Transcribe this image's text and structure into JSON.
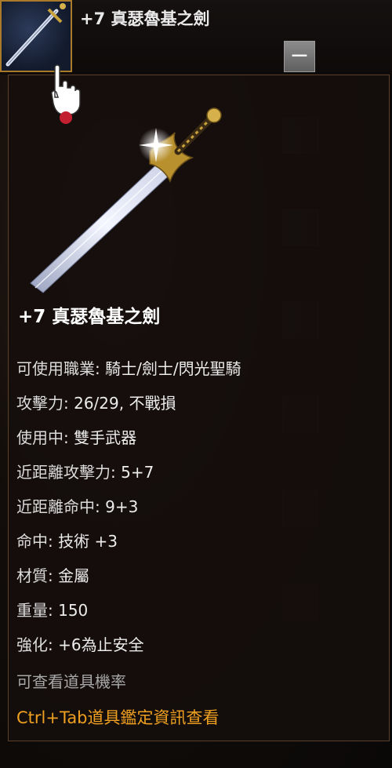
{
  "header": {
    "title": "+7 真瑟魯基之劍",
    "collapse_symbol": "−"
  },
  "tooltip": {
    "item_name": "+7 真瑟魯基之劍",
    "stats": [
      {
        "label": "可使用職業",
        "sep": ": ",
        "value": "騎士/劍士/閃光聖騎"
      },
      {
        "label": "攻擊力",
        "sep": ": ",
        "value": "26/29, 不戰損"
      },
      {
        "label": "使用中",
        "sep": ": ",
        "value": "雙手武器"
      },
      {
        "label": "近距離攻擊力",
        "sep": ": ",
        "value": "5+7"
      },
      {
        "label": "近距離命中",
        "sep": ": ",
        "value": "9+3"
      },
      {
        "label": "命中",
        "sep": ": ",
        "value": "技術 +3"
      },
      {
        "label": "材質",
        "sep": ": ",
        "value": "金屬"
      },
      {
        "label": "重量",
        "sep": ": ",
        "value": "150"
      },
      {
        "label": "強化",
        "sep": ": ",
        "value": "+6為止安全"
      }
    ],
    "hint_gray": "可查看道具機率",
    "hint_gold": "Ctrl+Tab道具鑑定資訊查看"
  },
  "icons": {
    "item_thumbnail": "sword-thumbnail-icon",
    "cursor": "hand-cursor-icon",
    "item_art": "sword-icon"
  },
  "colors": {
    "tooltip_border": "#5a4128",
    "thumb_border": "#a87a2a",
    "hint_gold": "#f0a020"
  }
}
